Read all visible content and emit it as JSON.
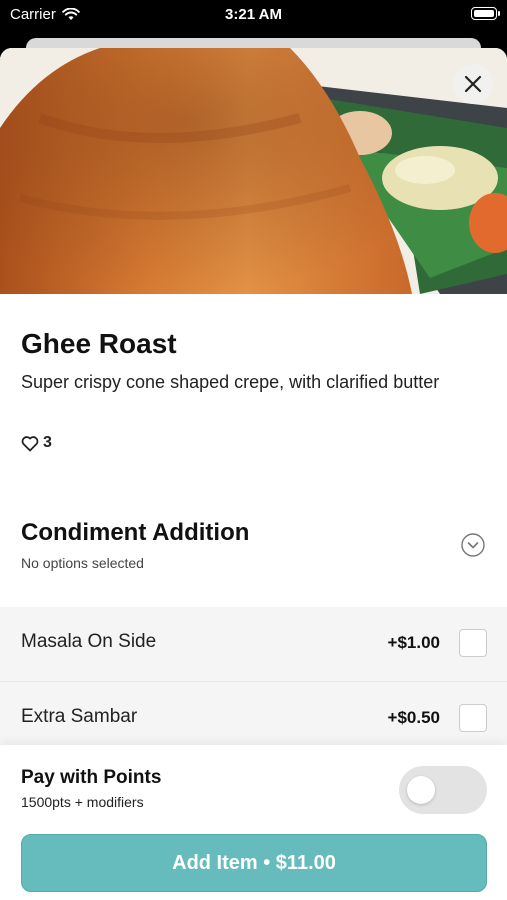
{
  "status_bar": {
    "carrier": "Carrier",
    "time": "3:21 AM"
  },
  "item": {
    "name": "Ghee Roast",
    "description": "Super crispy cone shaped crepe, with clarified butter",
    "likes": "3"
  },
  "modifier_group": {
    "title": "Condiment Addition",
    "subtitle": "No options selected",
    "options": [
      {
        "label": "Masala On Side",
        "price": "+$1.00",
        "selected": false
      },
      {
        "label": "Extra Sambar",
        "price": "+$0.50",
        "selected": false
      }
    ]
  },
  "points": {
    "title": "Pay with Points",
    "subtitle": "1500pts + modifiers",
    "enabled": false
  },
  "add_button": {
    "label": "Add Item • $11.00"
  },
  "colors": {
    "accent": "#66bcbd",
    "toggle_off": "#e3e3e3",
    "options_bg": "#f5f5f5"
  }
}
